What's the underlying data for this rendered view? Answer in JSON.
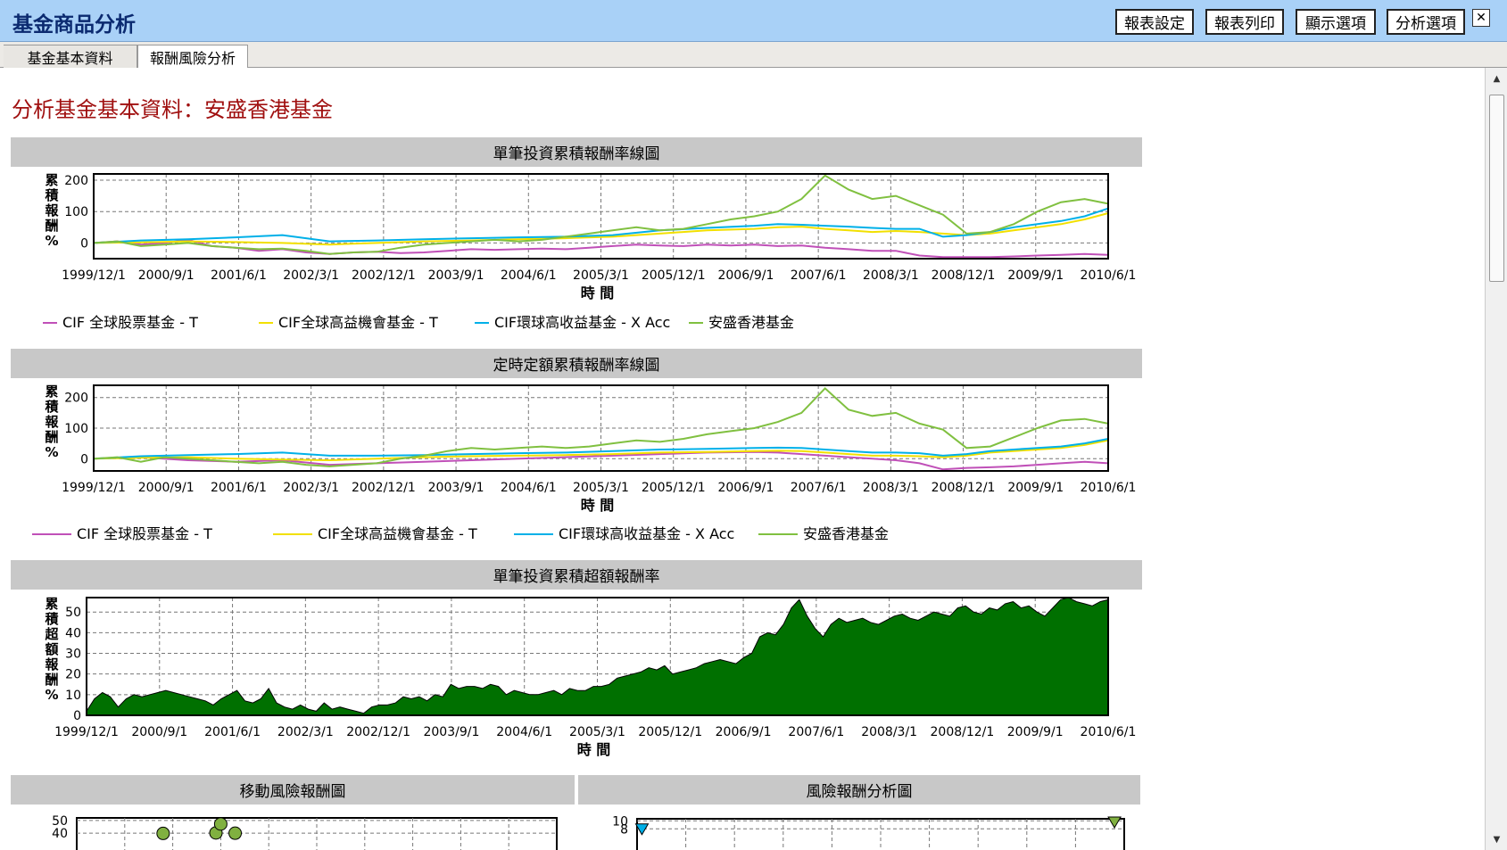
{
  "app": {
    "title": "基金商品分析"
  },
  "toolbar": {
    "report_settings": "報表設定",
    "report_print": "報表列印",
    "display_options": "顯示選項",
    "analysis_options": "分析選項",
    "close_glyph": "✕"
  },
  "tabs": [
    {
      "label": "基金基本資料",
      "active": false
    },
    {
      "label": "報酬風險分析",
      "active": true
    }
  ],
  "page": {
    "heading": "分析基金基本資料：安盛香港基金"
  },
  "colors": {
    "series": [
      "#c050b8",
      "#f2e000",
      "#00b0e8",
      "#80c040"
    ],
    "area": "#007000",
    "marker_green": "#80b040"
  },
  "chart_data": [
    {
      "type": "line",
      "title": "單筆投資累積報酬率線圖",
      "xlabel": "時 間",
      "ylabel": "累積報酬%",
      "xticks": [
        "1999/12/1",
        "2000/9/1",
        "2001/6/1",
        "2002/3/1",
        "2002/12/1",
        "2003/9/1",
        "2004/6/1",
        "2005/3/1",
        "2005/12/1",
        "2006/9/1",
        "2007/6/1",
        "2008/3/1",
        "2008/12/1",
        "2009/9/1",
        "2010/6/1"
      ],
      "yticks": [
        0,
        100,
        200
      ],
      "ylim": [
        -50,
        220
      ],
      "series": [
        {
          "name": "CIF 全球股票基金 - T",
          "x": [
            0,
            3,
            6,
            9,
            12,
            15,
            18,
            21,
            24,
            27,
            30,
            33,
            36,
            39,
            42,
            45,
            48,
            51,
            54,
            57,
            60,
            63,
            66,
            69,
            72,
            75,
            78,
            81,
            84,
            87,
            90,
            93,
            96,
            99,
            102,
            105,
            108,
            111,
            114,
            117,
            120,
            123,
            126,
            129
          ],
          "values": [
            0,
            5,
            -5,
            0,
            10,
            -10,
            -15,
            -25,
            -20,
            -30,
            -35,
            -30,
            -28,
            -32,
            -30,
            -25,
            -20,
            -22,
            -20,
            -18,
            -20,
            -15,
            -10,
            -5,
            -8,
            -10,
            -5,
            -8,
            -5,
            -10,
            -8,
            -15,
            -20,
            -25,
            -25,
            -40,
            -45,
            -45,
            -45,
            -43,
            -40,
            -38,
            -35,
            -38
          ]
        },
        {
          "name": "CIF全球高益機會基金 - T",
          "x": [
            0,
            6,
            12,
            18,
            24,
            30,
            36,
            42,
            48,
            54,
            60,
            66,
            72,
            78,
            84,
            87,
            90,
            93,
            96,
            99,
            102,
            105,
            108,
            111,
            114,
            117,
            120,
            123,
            126,
            129
          ],
          "values": [
            0,
            2,
            5,
            3,
            0,
            -5,
            0,
            5,
            8,
            12,
            15,
            20,
            30,
            40,
            45,
            50,
            52,
            45,
            40,
            35,
            38,
            35,
            30,
            25,
            30,
            40,
            50,
            60,
            75,
            95
          ]
        },
        {
          "name": "CIF環球高收益基金 - X Acc",
          "x": [
            0,
            6,
            12,
            18,
            24,
            30,
            36,
            42,
            48,
            54,
            60,
            66,
            72,
            78,
            84,
            87,
            90,
            93,
            96,
            99,
            102,
            105,
            108,
            111,
            114,
            117,
            120,
            123,
            126,
            129
          ],
          "values": [
            0,
            8,
            12,
            18,
            25,
            5,
            8,
            12,
            15,
            18,
            20,
            25,
            40,
            48,
            55,
            60,
            58,
            55,
            52,
            48,
            45,
            45,
            20,
            25,
            35,
            50,
            60,
            70,
            85,
            110
          ]
        },
        {
          "name": "安盛香港基金",
          "x": [
            0,
            3,
            6,
            9,
            12,
            15,
            18,
            21,
            24,
            27,
            30,
            33,
            36,
            39,
            42,
            45,
            48,
            51,
            54,
            57,
            60,
            63,
            66,
            69,
            72,
            75,
            78,
            81,
            84,
            87,
            90,
            93,
            96,
            99,
            102,
            105,
            108,
            111,
            114,
            117,
            120,
            123,
            126,
            129
          ],
          "values": [
            0,
            5,
            -10,
            -5,
            0,
            -10,
            -15,
            -20,
            -18,
            -25,
            -35,
            -30,
            -28,
            -15,
            -5,
            0,
            5,
            10,
            5,
            10,
            20,
            30,
            40,
            50,
            40,
            45,
            60,
            75,
            85,
            100,
            140,
            215,
            170,
            140,
            150,
            120,
            90,
            30,
            35,
            60,
            100,
            130,
            140,
            125
          ]
        }
      ]
    },
    {
      "type": "line",
      "title": "定時定額累積報酬率線圖",
      "xlabel": "時 間",
      "ylabel": "累積報酬%",
      "xticks": [
        "1999/12/1",
        "2000/9/1",
        "2001/6/1",
        "2002/3/1",
        "2002/12/1",
        "2003/9/1",
        "2004/6/1",
        "2005/3/1",
        "2005/12/1",
        "2006/9/1",
        "2007/6/1",
        "2008/3/1",
        "2008/12/1",
        "2009/9/1",
        "2010/6/1"
      ],
      "yticks": [
        0,
        100,
        200
      ],
      "ylim": [
        -40,
        240
      ],
      "series": [
        {
          "name": "CIF 全球股票基金 - T",
          "x": [
            0,
            6,
            12,
            18,
            24,
            30,
            36,
            42,
            48,
            54,
            60,
            66,
            72,
            78,
            84,
            87,
            90,
            93,
            96,
            99,
            102,
            105,
            108,
            111,
            114,
            117,
            120,
            123,
            126,
            129
          ],
          "values": [
            0,
            5,
            -5,
            -10,
            -5,
            -20,
            -15,
            -10,
            -5,
            0,
            5,
            10,
            15,
            20,
            22,
            20,
            15,
            10,
            5,
            0,
            -5,
            -15,
            -35,
            -30,
            -28,
            -25,
            -20,
            -15,
            -10,
            -15
          ]
        },
        {
          "name": "CIF全球高益機會基金 - T",
          "x": [
            0,
            6,
            12,
            18,
            24,
            30,
            36,
            42,
            48,
            54,
            60,
            66,
            72,
            78,
            84,
            87,
            90,
            93,
            96,
            99,
            102,
            105,
            108,
            111,
            114,
            117,
            120,
            123,
            126,
            129
          ],
          "values": [
            0,
            3,
            5,
            0,
            -3,
            -5,
            0,
            5,
            8,
            10,
            12,
            15,
            20,
            22,
            25,
            26,
            25,
            20,
            15,
            10,
            10,
            8,
            5,
            10,
            20,
            25,
            30,
            35,
            45,
            60
          ]
        },
        {
          "name": "CIF環球高收益基金 - X Acc",
          "x": [
            0,
            6,
            12,
            18,
            24,
            30,
            36,
            42,
            48,
            54,
            60,
            66,
            72,
            78,
            84,
            87,
            90,
            93,
            96,
            99,
            102,
            105,
            108,
            111,
            114,
            117,
            120,
            123,
            126,
            129
          ],
          "values": [
            0,
            8,
            12,
            15,
            20,
            10,
            10,
            12,
            15,
            18,
            20,
            25,
            30,
            32,
            35,
            36,
            35,
            30,
            25,
            20,
            20,
            18,
            10,
            15,
            25,
            30,
            35,
            40,
            50,
            65
          ]
        },
        {
          "name": "安盛香港基金",
          "x": [
            0,
            3,
            6,
            9,
            12,
            15,
            18,
            21,
            24,
            27,
            30,
            33,
            36,
            39,
            42,
            45,
            48,
            51,
            54,
            57,
            60,
            63,
            66,
            69,
            72,
            75,
            78,
            81,
            84,
            87,
            90,
            93,
            96,
            99,
            102,
            105,
            108,
            111,
            114,
            117,
            120,
            123,
            126,
            129
          ],
          "values": [
            0,
            5,
            -10,
            5,
            0,
            -5,
            -10,
            -15,
            -10,
            -20,
            -25,
            -20,
            -15,
            0,
            10,
            25,
            35,
            30,
            35,
            40,
            35,
            40,
            50,
            60,
            55,
            65,
            80,
            90,
            100,
            120,
            150,
            230,
            160,
            140,
            150,
            115,
            95,
            35,
            40,
            70,
            100,
            125,
            130,
            115
          ]
        }
      ]
    },
    {
      "type": "area",
      "title": "單筆投資累積超額報酬率",
      "xlabel": "時 間",
      "ylabel": "累積超額報酬%",
      "xticks": [
        "1999/12/1",
        "2000/9/1",
        "2001/6/1",
        "2002/3/1",
        "2002/12/1",
        "2003/9/1",
        "2004/6/1",
        "2005/3/1",
        "2005/12/1",
        "2006/9/1",
        "2007/6/1",
        "2008/3/1",
        "2008/12/1",
        "2009/9/1",
        "2010/6/1"
      ],
      "yticks": [
        0,
        10,
        20,
        30,
        40,
        50
      ],
      "ylim": [
        0,
        57
      ],
      "series": [
        {
          "name": "",
          "x": [
            0,
            1,
            2,
            3,
            4,
            5,
            6,
            7,
            8,
            9,
            10,
            11,
            12,
            13,
            14,
            15,
            16,
            17,
            18,
            19,
            20,
            21,
            22,
            23,
            24,
            25,
            26,
            27,
            28,
            29,
            30,
            31,
            32,
            33,
            34,
            35,
            36,
            37,
            38,
            39,
            40,
            41,
            42,
            43,
            44,
            45,
            46,
            47,
            48,
            49,
            50,
            51,
            52,
            53,
            54,
            55,
            56,
            57,
            58,
            59,
            60,
            61,
            62,
            63,
            64,
            65,
            66,
            67,
            68,
            69,
            70,
            71,
            72,
            73,
            74,
            75,
            76,
            77,
            78,
            79,
            80,
            81,
            82,
            83,
            84,
            85,
            86,
            87,
            88,
            89,
            90,
            91,
            92,
            93,
            94,
            95,
            96,
            97,
            98,
            99,
            100,
            101,
            102,
            103,
            104,
            105,
            106,
            107,
            108,
            109,
            110,
            111,
            112,
            113,
            114,
            115,
            116,
            117,
            118,
            119,
            120,
            121,
            122,
            123,
            124,
            125,
            126,
            127,
            128,
            129
          ],
          "values": [
            2,
            8,
            11,
            9,
            4,
            8,
            10,
            9,
            10,
            11,
            12,
            11,
            10,
            9,
            8,
            7,
            5,
            8,
            10,
            12,
            7,
            6,
            8,
            13,
            6,
            4,
            3,
            5,
            3,
            2,
            6,
            3,
            4,
            3,
            2,
            1,
            4,
            5,
            5,
            6,
            9,
            8,
            9,
            7,
            10,
            9,
            15,
            13,
            14,
            14,
            13,
            15,
            14,
            10,
            12,
            11,
            10,
            10,
            11,
            12,
            10,
            13,
            12,
            12,
            14,
            14,
            15,
            18,
            19,
            20,
            21,
            23,
            22,
            24,
            20,
            21,
            22,
            23,
            25,
            26,
            27,
            26,
            25,
            28,
            30,
            38,
            40,
            39,
            44,
            52,
            56,
            48,
            42,
            38,
            44,
            47,
            45,
            46,
            47,
            45,
            44,
            46,
            48,
            49,
            47,
            46,
            48,
            50,
            49,
            48,
            52,
            53,
            50,
            49,
            52,
            51,
            54,
            55,
            52,
            53,
            50,
            48,
            52,
            56,
            57,
            55,
            54,
            53,
            55,
            56
          ]
        }
      ]
    },
    {
      "type": "scatter",
      "title": "移動風險報酬圖",
      "yticks": [
        40,
        50
      ],
      "ylim": [
        38,
        52
      ],
      "series": [
        {
          "name": "",
          "x": [
            1.8,
            2.9,
            3.0,
            3.3
          ],
          "values": [
            39.8,
            40.2,
            47.2,
            40.0
          ]
        }
      ]
    },
    {
      "type": "scatter",
      "title": "風險報酬分析圖",
      "yticks": [
        8,
        10
      ],
      "ylim": [
        7.5,
        10.5
      ],
      "series": [
        {
          "name": "",
          "x": [
            0.1,
            9.8
          ],
          "values": [
            7.9,
            9.6
          ]
        }
      ]
    }
  ]
}
